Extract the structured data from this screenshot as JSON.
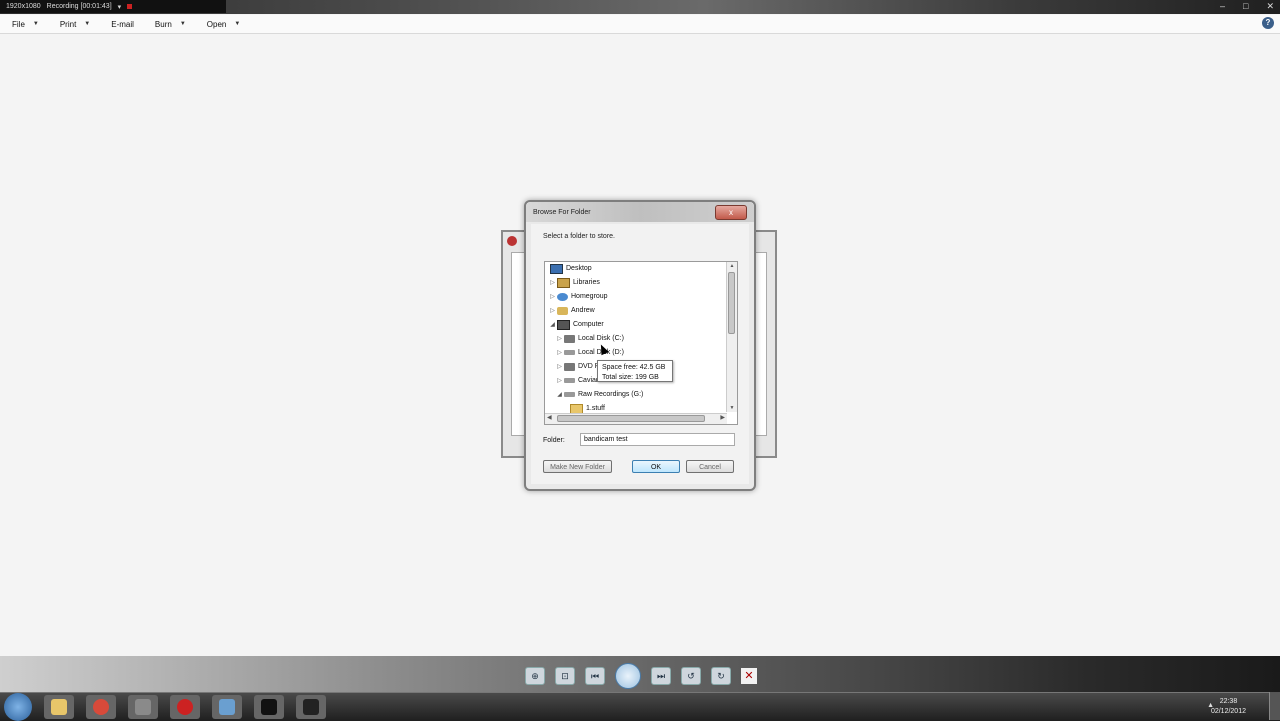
{
  "recorder_bar": {
    "resolution": "1920x1080",
    "status": "Recording [00:01:43]"
  },
  "menubar": {
    "items": [
      {
        "label": "File",
        "has_arrow": true
      },
      {
        "label": "Print",
        "has_arrow": true
      },
      {
        "label": "E-mail",
        "has_arrow": false
      },
      {
        "label": "Burn",
        "has_arrow": true
      },
      {
        "label": "Open",
        "has_arrow": true
      }
    ],
    "help": "?"
  },
  "dialog": {
    "title": "Browse For Folder",
    "close": "x",
    "instruction": "Select a folder to store.",
    "tree": [
      {
        "label": "Desktop",
        "icon": "desktop-icon"
      },
      {
        "label": "Libraries",
        "icon": "libraries-icon"
      },
      {
        "label": "Homegroup",
        "icon": "homegroup-icon"
      },
      {
        "label": "Andrew",
        "icon": "user-folder-icon"
      },
      {
        "label": "Computer",
        "icon": "computer-icon"
      },
      {
        "label": "Local Disk (C:)",
        "icon": "disk-icon"
      },
      {
        "label": "Local Disk (D:)",
        "icon": "drive-icon"
      },
      {
        "label": "DVD R",
        "icon": "dvd-icon"
      },
      {
        "label": "Caviar",
        "icon": "drive-icon"
      },
      {
        "label": "Raw Recordings (G:)",
        "icon": "drive-icon"
      },
      {
        "label": "1.stuff",
        "icon": "folder-icon"
      }
    ],
    "tooltip": {
      "line1": "Space free: 42.5 GB",
      "line2": "Total size: 199 GB"
    },
    "folder_label": "Folder:",
    "folder_value": "bandicam test",
    "buttons": {
      "make_new_folder": "Make New Folder",
      "ok": "OK",
      "cancel": "Cancel"
    }
  },
  "taskbar": {
    "time": "22:38",
    "date": "02/12/2012",
    "close_glyph": "✕"
  },
  "colors": {
    "accent": "#3c7fb1",
    "record": "#cc2222"
  }
}
